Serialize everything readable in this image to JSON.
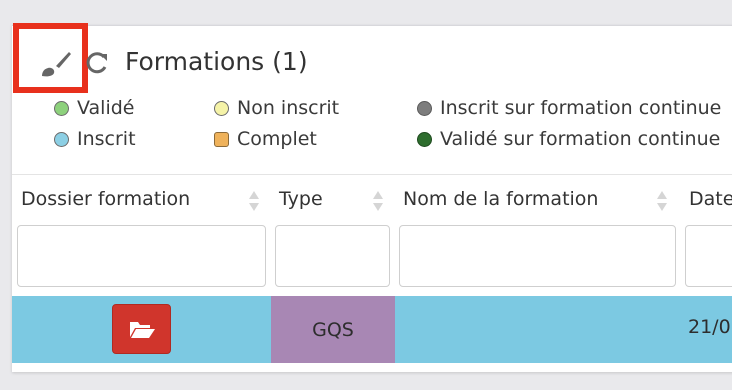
{
  "header": {
    "title": "Formations (1)"
  },
  "legend": [
    {
      "label": "Validé",
      "color": "#8dd17c",
      "shape": "circle"
    },
    {
      "label": "Inscrit",
      "color": "#8ccfe4",
      "shape": "circle"
    },
    {
      "label": "Non inscrit",
      "color": "#f5f3a8",
      "shape": "circle"
    },
    {
      "label": "Complet",
      "color": "#efb25b",
      "shape": "square"
    },
    {
      "label": "Inscrit sur formation continue",
      "color": "#7d7d7d",
      "shape": "circle"
    },
    {
      "label": "Validé sur formation continue",
      "color": "#2e6d2e",
      "shape": "circle"
    }
  ],
  "table": {
    "columns": [
      "Dossier formation",
      "Type",
      "Nom de la formation",
      "Date"
    ],
    "rows": [
      {
        "type": "GQS",
        "nom": "",
        "date": "21/0"
      }
    ]
  },
  "colors": {
    "row_bg": "#7cc9e2",
    "type_bg": "#a887b4",
    "button_red": "#d0352c",
    "highlight": "#e8301c"
  },
  "icons": [
    "paintbrush-icon",
    "refresh-icon",
    "folder-open-icon",
    "sort-icon"
  ]
}
